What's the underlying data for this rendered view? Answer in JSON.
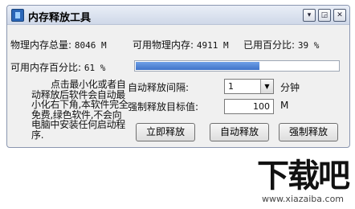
{
  "window": {
    "title": "内存释放工具",
    "buttons": {
      "dropdown": "▾",
      "restore": "◲",
      "close": "✕"
    }
  },
  "stats": {
    "total_label": "物理内存总量:",
    "total_value": "8046 M",
    "avail_label": "可用物理内存:",
    "avail_value": "4911 M",
    "used_label": "已用百分比:",
    "used_value": "39 %",
    "avail_pct_label": "可用内存百分比:",
    "avail_pct_value": "61 %",
    "avail_pct_level": 61
  },
  "description": "点击最小化或者自动释放后软件会自动最小化右下角,本软件完全免费,绿色软件,不会向电脑中安装任何启动程序.",
  "form": {
    "interval_label": "自动释放间隔:",
    "interval_value": "1",
    "interval_unit": "分钟",
    "target_label": "强制释放目标值:",
    "target_value": "100",
    "target_unit": "M"
  },
  "actions": {
    "release_now": "立即释放",
    "auto_release": "自动释放",
    "force_release": "强制释放"
  },
  "watermark": {
    "main": "下载吧",
    "sub": "www.xiazaiba.com"
  },
  "colors": {
    "progress": "#4a7fd4",
    "titlebar": "#dbe3f0"
  }
}
